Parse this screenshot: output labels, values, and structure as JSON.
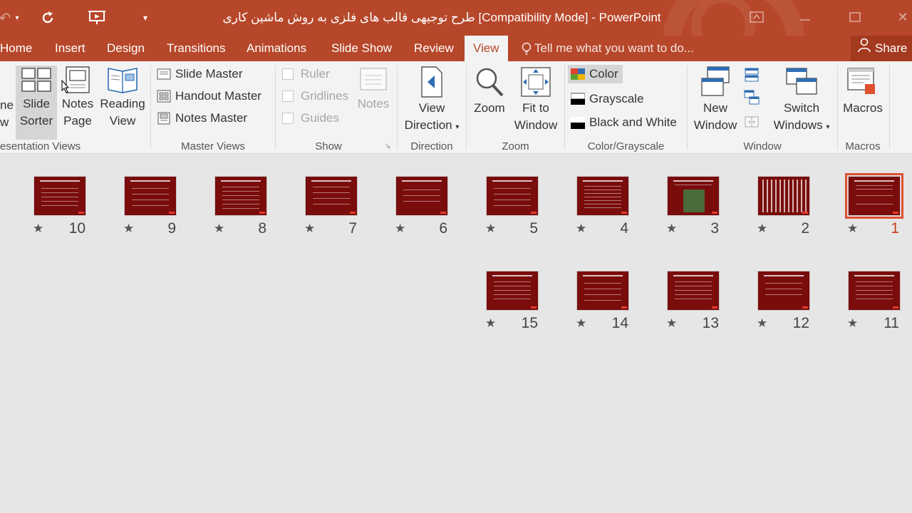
{
  "app": {
    "title": "طرح توجیهی قالب های فلزی به روش ماشین کاری [Compatibility Mode] - PowerPoint"
  },
  "quick_access": {
    "undo_icon": "redo-arrow-icon",
    "present_icon": "start-presentation-icon",
    "customize_icon": "chevron-down-icon"
  },
  "tabs": [
    "Home",
    "Insert",
    "Design",
    "Transitions",
    "Animations",
    "Slide Show",
    "Review",
    "View"
  ],
  "active_tab": "View",
  "tell_me": "Tell me what you want to do...",
  "share_label": "Share",
  "ribbon": {
    "presentation_views": {
      "partial_btn_line1": "ne",
      "partial_btn_line2": "w",
      "slide_sorter_line1": "Slide",
      "slide_sorter_line2": "Sorter",
      "notes_page_line1": "Notes",
      "notes_page_line2": "Page",
      "reading_view_line1": "Reading",
      "reading_view_line2": "View",
      "label": "esentation Views"
    },
    "master_views": {
      "slide_master": "Slide Master",
      "handout_master": "Handout Master",
      "notes_master": "Notes Master",
      "label": "Master Views"
    },
    "show": {
      "ruler": "Ruler",
      "gridlines": "Gridlines",
      "guides": "Guides",
      "notes": "Notes",
      "label": "Show"
    },
    "direction": {
      "view_direction_line1": "View",
      "view_direction_line2": "Direction",
      "label": "Direction"
    },
    "zoom": {
      "zoom": "Zoom",
      "fit_line1": "Fit to",
      "fit_line2": "Window",
      "label": "Zoom"
    },
    "color": {
      "color": "Color",
      "grayscale": "Grayscale",
      "bw": "Black and White",
      "label": "Color/Grayscale"
    },
    "window": {
      "new_line1": "New",
      "new_line2": "Window",
      "switch_line1": "Switch",
      "switch_line2": "Windows",
      "label": "Window"
    },
    "macros": {
      "macros": "Macros",
      "label": "Macros"
    }
  },
  "slides_row1": [
    "10",
    "9",
    "8",
    "7",
    "6",
    "5",
    "4",
    "3",
    "2",
    "1"
  ],
  "slides_row2": [
    "15",
    "14",
    "13",
    "12",
    "11"
  ],
  "selected_slide": "1",
  "colors": {
    "accent": "#b7472a",
    "slide_bg": "#7a0c0c",
    "selection": "#e0502f"
  }
}
